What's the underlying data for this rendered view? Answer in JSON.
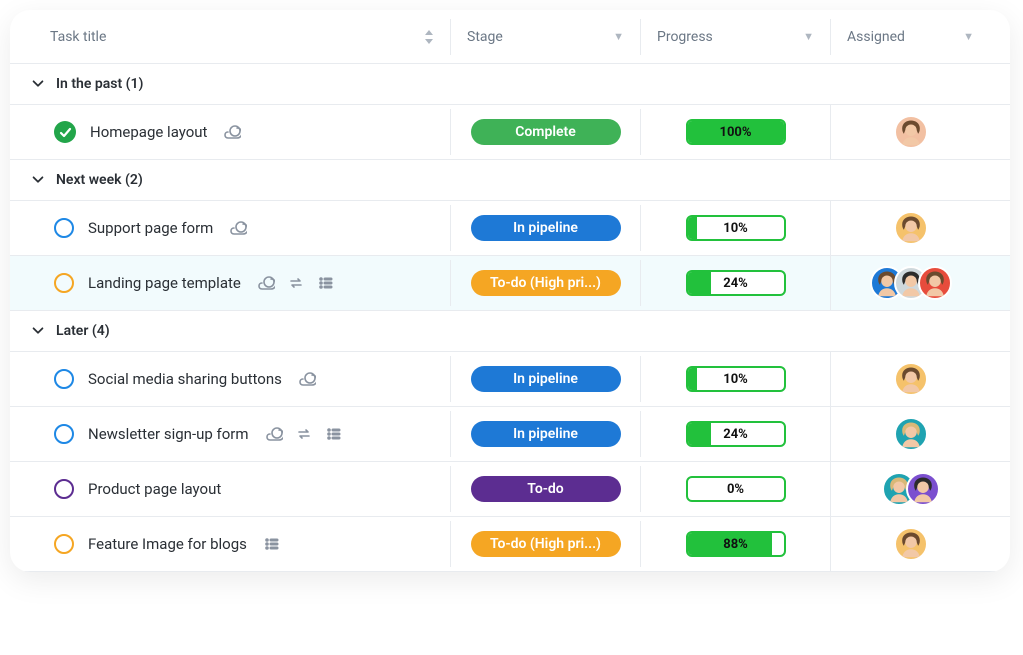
{
  "columns": {
    "title": "Task title",
    "stage": "Stage",
    "progress": "Progress",
    "assigned": "Assigned"
  },
  "colors": {
    "complete": "#3fb257",
    "pipeline": "#1e79d6",
    "todo_high": "#f5a623",
    "todo": "#5c2d91",
    "progress_bar": "#22c13c"
  },
  "groups": [
    {
      "label": "In the past (1)",
      "tasks": [
        {
          "title": "Homepage layout",
          "status_icon": "check",
          "stage_label": "Complete",
          "stage_style": "green",
          "progress_label": "100%",
          "progress_value": 100,
          "icons": [
            "attachment"
          ],
          "assignees": [
            {
              "bg": "peach",
              "hair": "br"
            }
          ],
          "highlight": false
        }
      ]
    },
    {
      "label": "Next week (2)",
      "tasks": [
        {
          "title": "Support page form",
          "status_icon": "blue",
          "stage_label": "In pipeline",
          "stage_style": "blue",
          "progress_label": "10%",
          "progress_value": 10,
          "icons": [
            "attachment"
          ],
          "assignees": [
            {
              "bg": "yellow",
              "hair": "br"
            }
          ],
          "highlight": false
        },
        {
          "title": "Landing page template",
          "status_icon": "orange",
          "stage_label": "To-do (High pri...)",
          "stage_style": "orange",
          "progress_label": "24%",
          "progress_value": 24,
          "icons": [
            "attachment",
            "repeat",
            "list"
          ],
          "assignees": [
            {
              "bg": "blue",
              "hair": "br"
            },
            {
              "bg": "grey",
              "hair": "dk"
            },
            {
              "bg": "red",
              "hair": "br"
            }
          ],
          "highlight": true
        }
      ]
    },
    {
      "label": "Later (4)",
      "tasks": [
        {
          "title": "Social media sharing buttons",
          "status_icon": "blue",
          "stage_label": "In pipeline",
          "stage_style": "blue",
          "progress_label": "10%",
          "progress_value": 10,
          "icons": [
            "attachment"
          ],
          "assignees": [
            {
              "bg": "yellow",
              "hair": "br"
            }
          ],
          "highlight": false
        },
        {
          "title": "Newsletter sign-up form",
          "status_icon": "blue",
          "stage_label": "In pipeline",
          "stage_style": "blue",
          "progress_label": "24%",
          "progress_value": 24,
          "icons": [
            "attachment",
            "repeat",
            "list"
          ],
          "assignees": [
            {
              "bg": "teal",
              "hair": "bl"
            }
          ],
          "highlight": false
        },
        {
          "title": "Product page layout",
          "status_icon": "purple",
          "stage_label": "To-do",
          "stage_style": "purple",
          "progress_label": "0%",
          "progress_value": 0,
          "icons": [],
          "assignees": [
            {
              "bg": "teal",
              "hair": "bl"
            },
            {
              "bg": "purple",
              "hair": "dk"
            }
          ],
          "highlight": false
        },
        {
          "title": "Feature Image for blogs",
          "status_icon": "orange",
          "stage_label": "To-do (High pri...)",
          "stage_style": "orange",
          "progress_label": "88%",
          "progress_value": 88,
          "icons": [
            "list"
          ],
          "assignees": [
            {
              "bg": "yellow",
              "hair": "br"
            }
          ],
          "highlight": false
        }
      ]
    }
  ]
}
